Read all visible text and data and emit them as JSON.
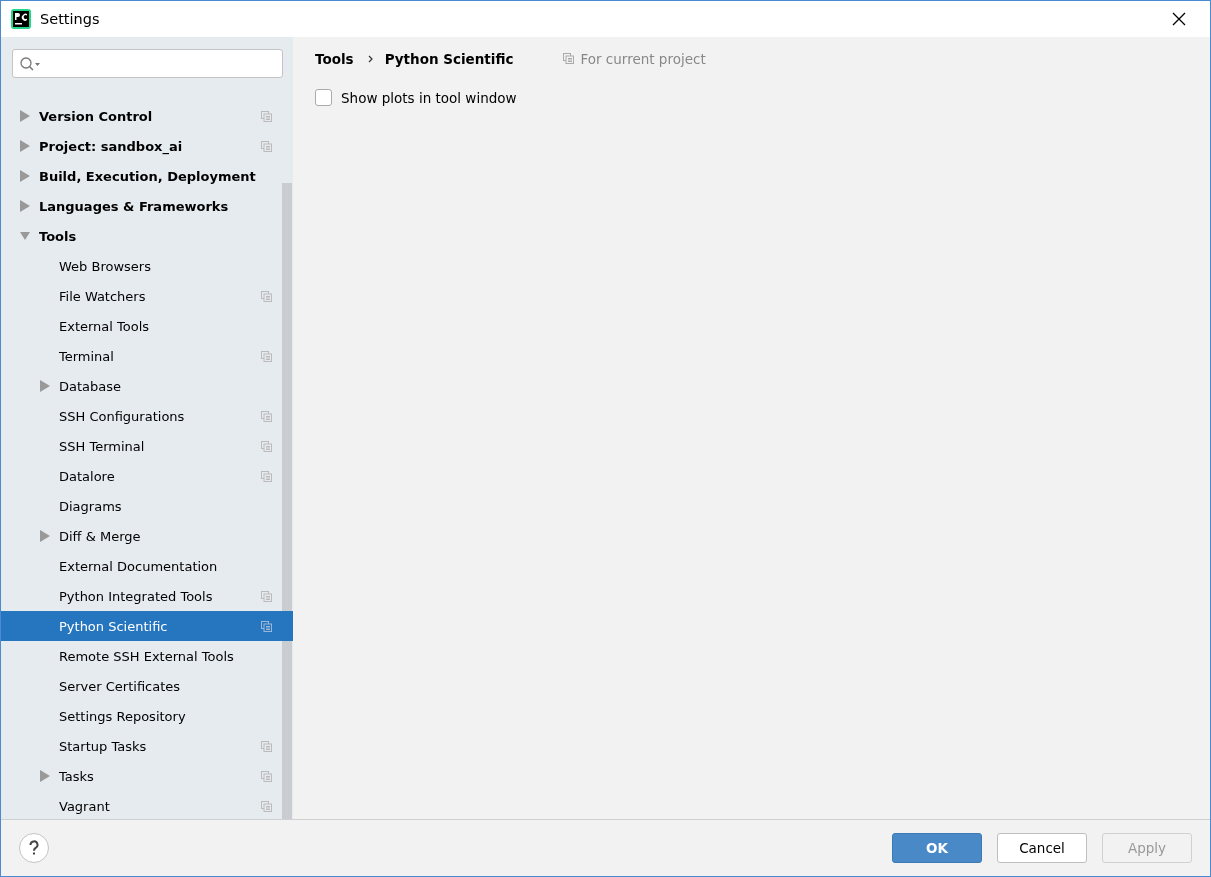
{
  "window": {
    "title": "Settings"
  },
  "tree": [
    {
      "label": "Version Control",
      "expanded": false,
      "project_level": true,
      "selected": false
    },
    {
      "label": "Project: sandbox_ai",
      "expanded": false,
      "project_level": true,
      "selected": false
    },
    {
      "label": "Build, Execution, Deployment",
      "expanded": false,
      "project_level": false,
      "selected": false
    },
    {
      "label": "Languages & Frameworks",
      "expanded": false,
      "project_level": false,
      "selected": false
    },
    {
      "label": "Tools",
      "expanded": true,
      "project_level": false,
      "selected": false,
      "children": [
        {
          "label": "Web Browsers",
          "project_level": false,
          "selected": false
        },
        {
          "label": "File Watchers",
          "project_level": true,
          "selected": false
        },
        {
          "label": "External Tools",
          "project_level": false,
          "selected": false
        },
        {
          "label": "Terminal",
          "project_level": true,
          "selected": false
        },
        {
          "label": "Database",
          "expanded": false,
          "project_level": false,
          "selected": false
        },
        {
          "label": "SSH Configurations",
          "project_level": true,
          "selected": false
        },
        {
          "label": "SSH Terminal",
          "project_level": true,
          "selected": false
        },
        {
          "label": "Datalore",
          "project_level": true,
          "selected": false
        },
        {
          "label": "Diagrams",
          "project_level": false,
          "selected": false
        },
        {
          "label": "Diff & Merge",
          "expanded": false,
          "project_level": false,
          "selected": false
        },
        {
          "label": "External Documentation",
          "project_level": false,
          "selected": false
        },
        {
          "label": "Python Integrated Tools",
          "project_level": true,
          "selected": false
        },
        {
          "label": "Python Scientific",
          "project_level": true,
          "selected": true
        },
        {
          "label": "Remote SSH External Tools",
          "project_level": false,
          "selected": false
        },
        {
          "label": "Server Certificates",
          "project_level": false,
          "selected": false
        },
        {
          "label": "Settings Repository",
          "project_level": false,
          "selected": false
        },
        {
          "label": "Startup Tasks",
          "project_level": true,
          "selected": false
        },
        {
          "label": "Tasks",
          "expanded": false,
          "project_level": true,
          "selected": false
        },
        {
          "label": "Vagrant",
          "project_level": true,
          "selected": false
        }
      ]
    }
  ],
  "breadcrumb": [
    "Tools",
    "Python Scientific"
  ],
  "scope_note": "For current project",
  "options": [
    {
      "label": "Show plots in tool window",
      "checked": false
    }
  ],
  "buttons": [
    {
      "label": "OK",
      "kind": "primary",
      "disabled": false
    },
    {
      "label": "Cancel",
      "kind": "normal",
      "disabled": false
    },
    {
      "label": "Apply",
      "kind": "normal",
      "disabled": true
    }
  ]
}
